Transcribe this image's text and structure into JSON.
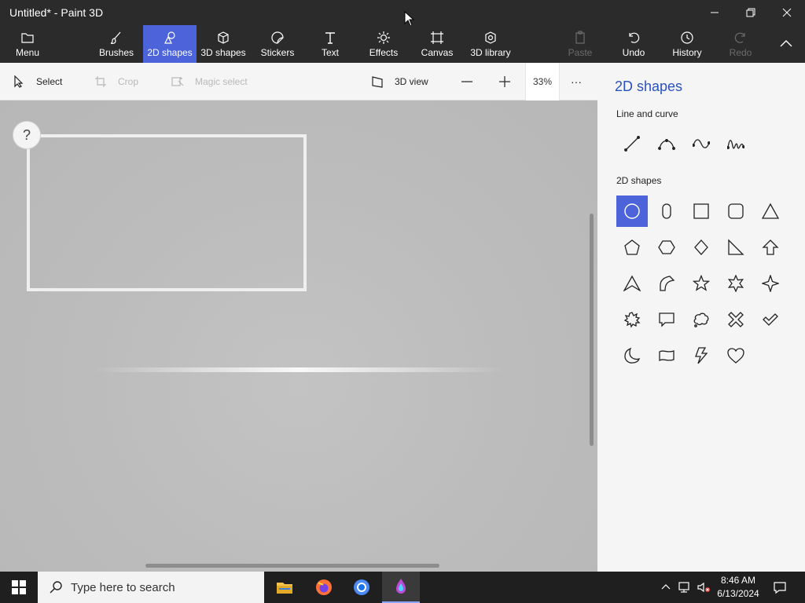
{
  "window": {
    "title": "Untitled* - Paint 3D"
  },
  "ribbon": {
    "menu": "Menu",
    "brushes": "Brushes",
    "shapes2d": "2D shapes",
    "shapes3d": "3D shapes",
    "stickers": "Stickers",
    "text": "Text",
    "effects": "Effects",
    "canvas": "Canvas",
    "library3d": "3D library",
    "paste": "Paste",
    "undo": "Undo",
    "history": "History",
    "redo": "Redo"
  },
  "toolbar": {
    "select": "Select",
    "crop": "Crop",
    "magic_select": "Magic select",
    "view3d": "3D view",
    "zoom": "33%",
    "more": "···"
  },
  "canvas": {
    "help": "?"
  },
  "panel": {
    "title": "2D shapes",
    "section_lines": "Line and curve",
    "section_shapes": "2D shapes",
    "line_tools": [
      "line-icon",
      "curve-icon",
      "wave-icon",
      "multi-wave-icon"
    ],
    "shapes": [
      "circle-icon",
      "capsule-icon",
      "square-icon",
      "rounded-square-icon",
      "triangle-icon",
      "pentagon-icon",
      "hexagon-icon",
      "diamond-icon",
      "right-triangle-icon",
      "arrow-up-icon",
      "arrowhead-icon",
      "quarter-circle-icon",
      "star-five-icon",
      "star-six-icon",
      "star-four-icon",
      "burst-icon",
      "speech-bubble-icon",
      "thought-bubble-icon",
      "cross-icon",
      "checkmark-icon",
      "crescent-icon",
      "banner-icon",
      "lightning-icon",
      "heart-icon"
    ],
    "selected_shape": "circle-icon",
    "accent": "#4c63d9",
    "heading_color": "#2a52be"
  },
  "taskbar": {
    "search_placeholder": "Type here to search",
    "time": "8:46 AM",
    "date": "6/13/2024"
  }
}
